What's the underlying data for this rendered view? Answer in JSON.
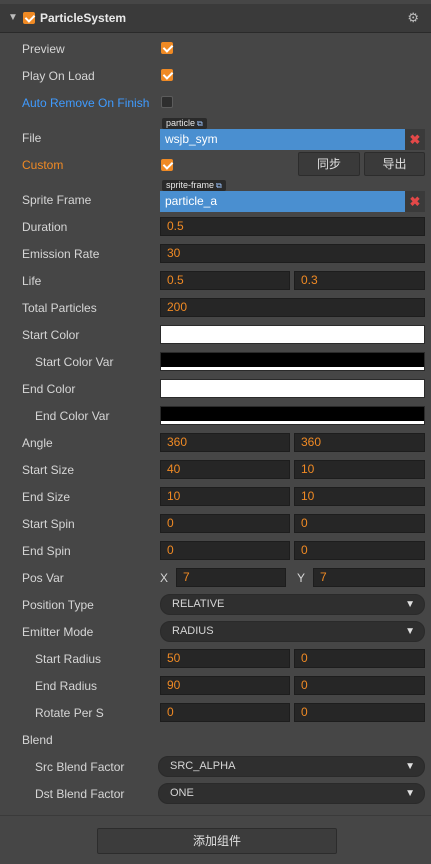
{
  "header": {
    "title": "ParticleSystem",
    "arrow": "▼",
    "gear": "⚙",
    "enabled": true
  },
  "rows": {
    "preview": {
      "label": "Preview",
      "checked": true
    },
    "play_on_load": {
      "label": "Play On Load",
      "checked": true
    },
    "auto_remove": {
      "label": "Auto Remove On Finish",
      "checked": false
    },
    "file": {
      "label": "File",
      "tag": "particle",
      "value": "wsjb_sym"
    },
    "custom": {
      "label": "Custom",
      "checked": true,
      "btn_sync": "同步",
      "btn_export": "导出"
    },
    "sprite_frame": {
      "label": "Sprite Frame",
      "tag": "sprite-frame",
      "value": "particle_a"
    },
    "duration": {
      "label": "Duration",
      "value": "0.5"
    },
    "emission_rate": {
      "label": "Emission Rate",
      "value": "30"
    },
    "life": {
      "label": "Life",
      "value": "0.5",
      "var": "0.3"
    },
    "total_particles": {
      "label": "Total Particles",
      "value": "200"
    },
    "start_color": {
      "label": "Start Color",
      "color": "#ffffff"
    },
    "start_color_var": {
      "label": "Start Color Var",
      "color": "#000000"
    },
    "end_color": {
      "label": "End Color",
      "color": "#ffffff"
    },
    "end_color_var": {
      "label": "End Color Var",
      "color": "#000000"
    },
    "angle": {
      "label": "Angle",
      "value": "360",
      "var": "360"
    },
    "start_size": {
      "label": "Start Size",
      "value": "40",
      "var": "10"
    },
    "end_size": {
      "label": "End Size",
      "value": "10",
      "var": "10"
    },
    "start_spin": {
      "label": "Start Spin",
      "value": "0",
      "var": "0"
    },
    "end_spin": {
      "label": "End Spin",
      "value": "0",
      "var": "0"
    },
    "pos_var": {
      "label": "Pos Var",
      "x_label": "X",
      "x": "7",
      "y_label": "Y",
      "y": "7"
    },
    "position_type": {
      "label": "Position Type",
      "value": "RELATIVE"
    },
    "emitter_mode": {
      "label": "Emitter Mode",
      "value": "RADIUS"
    },
    "start_radius": {
      "label": "Start Radius",
      "value": "50",
      "var": "0"
    },
    "end_radius": {
      "label": "End Radius",
      "value": "90",
      "var": "0"
    },
    "rotate_per_s": {
      "label": "Rotate Per S",
      "value": "0",
      "var": "0"
    },
    "blend": {
      "label": "Blend"
    },
    "src_blend": {
      "label": "Src Blend Factor",
      "value": "SRC_ALPHA"
    },
    "dst_blend": {
      "label": "Dst Blend Factor",
      "value": "ONE"
    }
  },
  "footer": {
    "add_component": "添加组件"
  },
  "colors": {
    "accent": "#f08a24",
    "link": "#3f9bff",
    "asset": "#4a8fd0",
    "panel": "#464646"
  }
}
